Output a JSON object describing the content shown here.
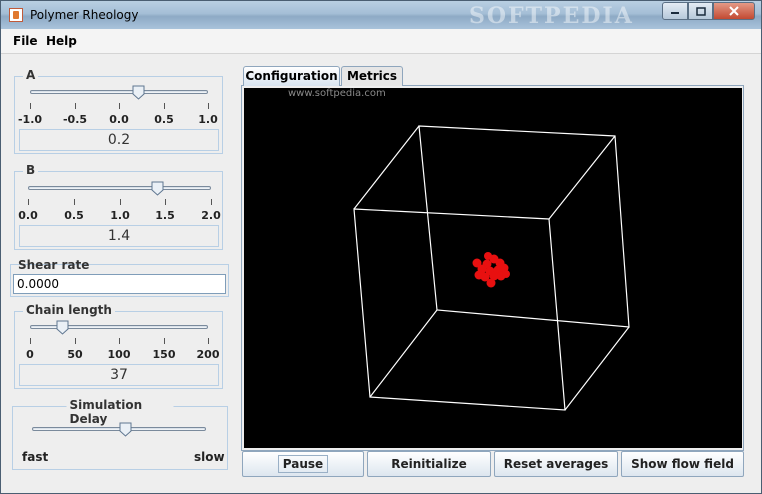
{
  "window": {
    "title": "Polymer Rheology",
    "watermark": "SOFTPEDIA"
  },
  "menu": {
    "file": "File",
    "help": "Help"
  },
  "panels": {
    "a": {
      "label": "A",
      "ticks": [
        "-1.0",
        "-0.5",
        "0.0",
        "0.5",
        "1.0"
      ],
      "value": "0.2",
      "min": -1.0,
      "max": 1.0
    },
    "b": {
      "label": "B",
      "ticks": [
        "0.0",
        "0.5",
        "1.0",
        "1.5",
        "2.0"
      ],
      "value": "1.4",
      "min": 0.0,
      "max": 2.0
    },
    "shear": {
      "label": "Shear rate",
      "value": "0.0000"
    },
    "chain": {
      "label": "Chain length",
      "ticks": [
        "0",
        "50",
        "100",
        "150",
        "200"
      ],
      "value": "37",
      "min": 0,
      "max": 200
    },
    "delay": {
      "label": "Simulation Delay",
      "fast": "fast",
      "slow": "slow",
      "level": 0.5
    }
  },
  "tabs": {
    "configuration": "Configuration",
    "metrics": "Metrics"
  },
  "canvas": {
    "watermark": "www.softpedia.com",
    "background": "#000000",
    "cube_color": "#ffffff",
    "polymer_color": "#e81010"
  },
  "buttons": {
    "pause": "Pause",
    "reinitialize": "Reinitialize",
    "reset": "Reset averages",
    "flow": "Show flow field"
  }
}
